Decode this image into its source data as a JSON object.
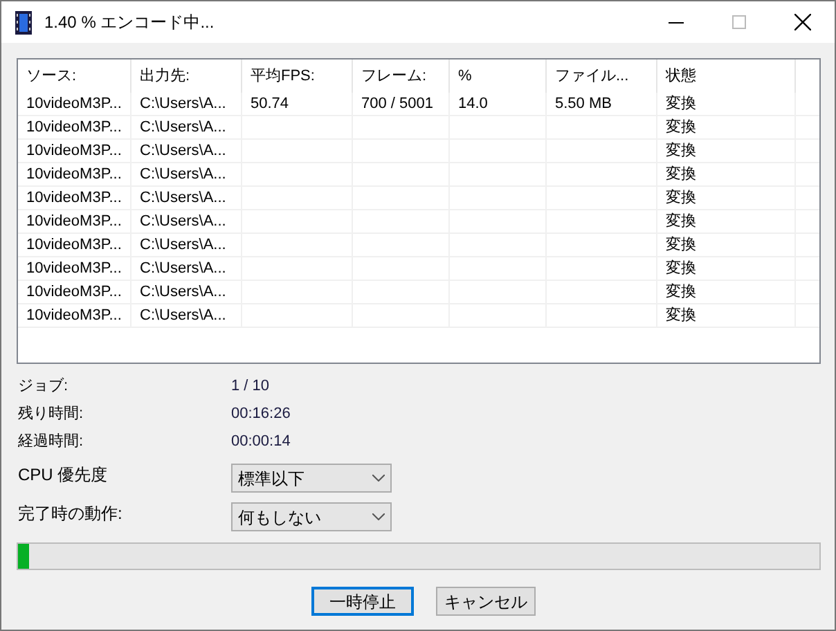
{
  "window": {
    "title": "1.40 % エンコード中..."
  },
  "table": {
    "columns": [
      "ソース:",
      "出力先:",
      "平均FPS:",
      "フレーム:",
      "%",
      "ファイル...",
      "状態"
    ],
    "rows": [
      [
        "10videoM3P...",
        "C:\\Users\\A...",
        "50.74",
        "700 / 5001",
        "14.0",
        "5.50 MB",
        "変換"
      ],
      [
        "10videoM3P...",
        "C:\\Users\\A...",
        "",
        "",
        "",
        "",
        "変換"
      ],
      [
        "10videoM3P...",
        "C:\\Users\\A...",
        "",
        "",
        "",
        "",
        "変換"
      ],
      [
        "10videoM3P...",
        "C:\\Users\\A...",
        "",
        "",
        "",
        "",
        "変換"
      ],
      [
        "10videoM3P...",
        "C:\\Users\\A...",
        "",
        "",
        "",
        "",
        "変換"
      ],
      [
        "10videoM3P...",
        "C:\\Users\\A...",
        "",
        "",
        "",
        "",
        "変換"
      ],
      [
        "10videoM3P...",
        "C:\\Users\\A...",
        "",
        "",
        "",
        "",
        "変換"
      ],
      [
        "10videoM3P...",
        "C:\\Users\\A...",
        "",
        "",
        "",
        "",
        "変換"
      ],
      [
        "10videoM3P...",
        "C:\\Users\\A...",
        "",
        "",
        "",
        "",
        "変換"
      ],
      [
        "10videoM3P...",
        "C:\\Users\\A...",
        "",
        "",
        "",
        "",
        "変換"
      ]
    ]
  },
  "info": [
    {
      "label": "ジョブ:",
      "value": "1 / 10"
    },
    {
      "label": "残り時間:",
      "value": "00:16:26"
    },
    {
      "label": "経過時間:",
      "value": "00:00:14"
    }
  ],
  "settings": [
    {
      "label": "CPU 優先度",
      "value": "標準以下"
    },
    {
      "label": "完了時の動作:",
      "value": "何もしない"
    }
  ],
  "progress": {
    "level": 0.014
  },
  "buttons": [
    {
      "label": "一時停止",
      "focused": true
    },
    {
      "label": "キャンセル",
      "focused": false
    }
  ]
}
